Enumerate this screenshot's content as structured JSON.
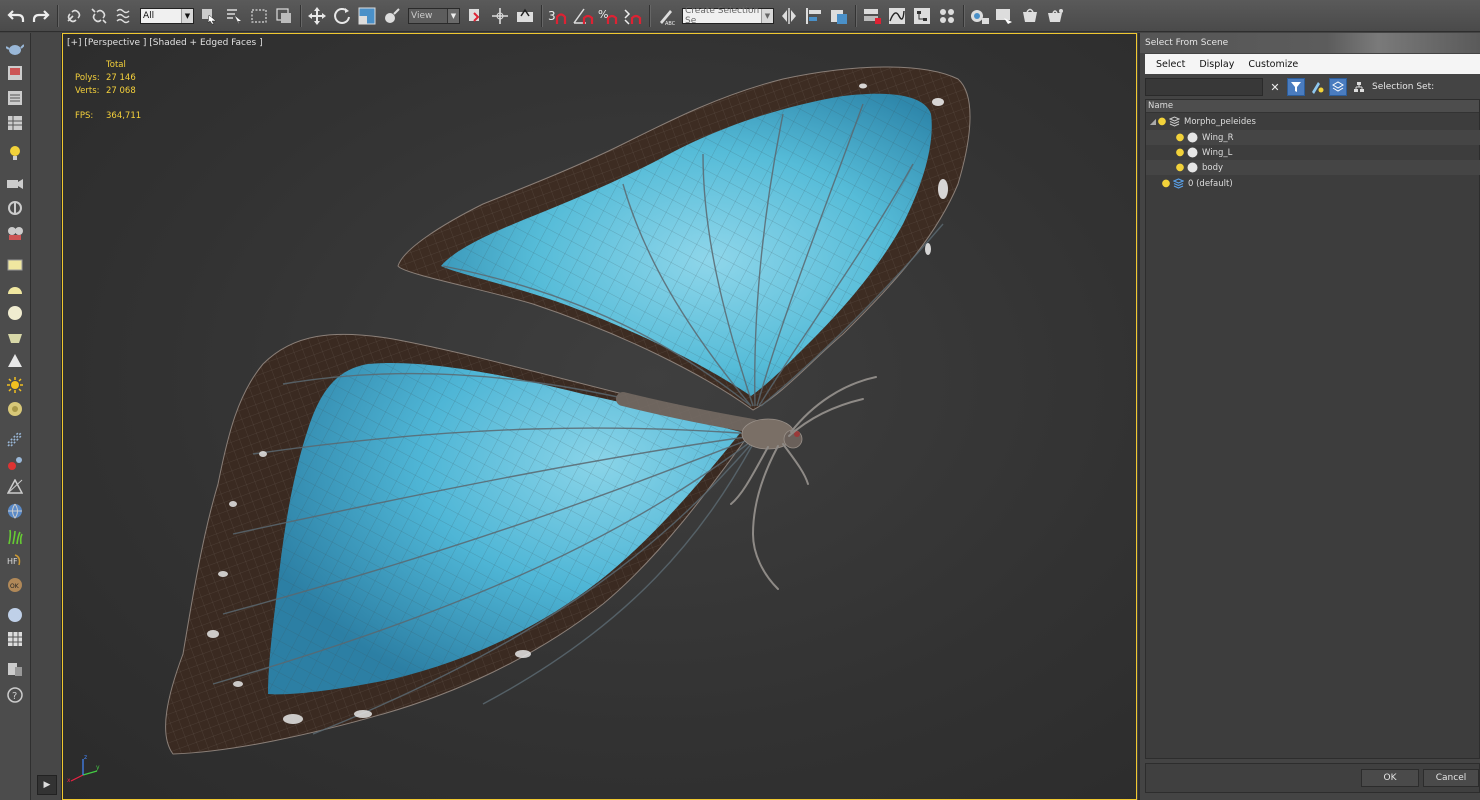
{
  "toolbar": {
    "selection_filter": "All",
    "reference_coord": "View",
    "named_selection_placeholder": "Create Selection Se"
  },
  "viewport": {
    "label": "[+] [Perspective ] [Shaded + Edged Faces ]",
    "stats": {
      "header": "Total",
      "polys_label": "Polys:",
      "polys_value": "27 146",
      "verts_label": "Verts:",
      "verts_value": "27 068",
      "fps_label": "FPS:",
      "fps_value": "364,711"
    },
    "axis": {
      "x": "x",
      "y": "y",
      "z": "z"
    }
  },
  "panel": {
    "title": "Select From Scene",
    "menu": [
      "Select",
      "Display",
      "Customize"
    ],
    "find_value": "",
    "selection_set_label": "Selection Set:",
    "column_name": "Name",
    "tree": [
      {
        "label": "Morpho_peleides",
        "level": 0,
        "expanded": true,
        "type": "layer"
      },
      {
        "label": "Wing_R",
        "level": 1,
        "type": "object"
      },
      {
        "label": "Wing_L",
        "level": 1,
        "type": "object"
      },
      {
        "label": "body",
        "level": 1,
        "type": "object"
      },
      {
        "label": "0 (default)",
        "level": 0,
        "type": "default-layer"
      }
    ],
    "ok_label": "OK",
    "cancel_label": "Cancel"
  },
  "colors": {
    "viewport_border": "#f0c830",
    "stats_text": "#f5d13b",
    "wing_blue": "#4fb8d8",
    "active_tool": "#4a7cbf"
  }
}
